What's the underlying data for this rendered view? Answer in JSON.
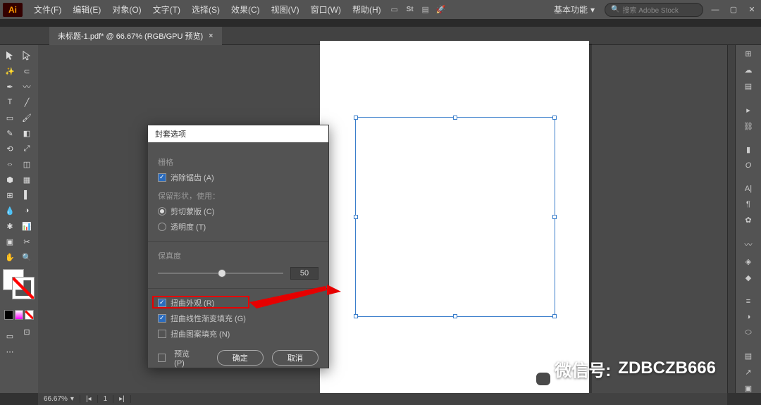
{
  "app": {
    "logo": "Ai"
  },
  "menu": {
    "file": "文件(F)",
    "edit": "编辑(E)",
    "object": "对象(O)",
    "type": "文字(T)",
    "select": "选择(S)",
    "effect": "效果(C)",
    "view": "视图(V)",
    "window": "窗口(W)",
    "help": "帮助(H)"
  },
  "header": {
    "workspace": "基本功能",
    "search_placeholder": "搜索 Adobe Stock"
  },
  "tab": {
    "title": "未标题-1.pdf* @ 66.67% (RGB/GPU 预览)"
  },
  "dialog": {
    "title": "封套选项",
    "raster_label": "栅格",
    "antialias": "消除锯齿 (A)",
    "preserve_label": "保留形状，使用：",
    "clip": "剪切蒙版 (C)",
    "transparency": "透明度 (T)",
    "fidelity_label": "保真度",
    "fidelity_value": "50",
    "distort_appearance": "扭曲外观 (R)",
    "distort_linear": "扭曲线性渐变填充 (G)",
    "distort_pattern": "扭曲图案填充 (N)",
    "preview": "预览 (P)",
    "ok": "确定",
    "cancel": "取消"
  },
  "status": {
    "zoom": "66.67%",
    "artboard": "1",
    "nav": "▸ | ◂"
  },
  "watermark": {
    "label": "微信号:",
    "id": "ZDBCZB666"
  },
  "colors": {
    "grad_a": "#e59bff",
    "grad_b": "#ff2bf3",
    "sel": "#3a7ecb"
  }
}
